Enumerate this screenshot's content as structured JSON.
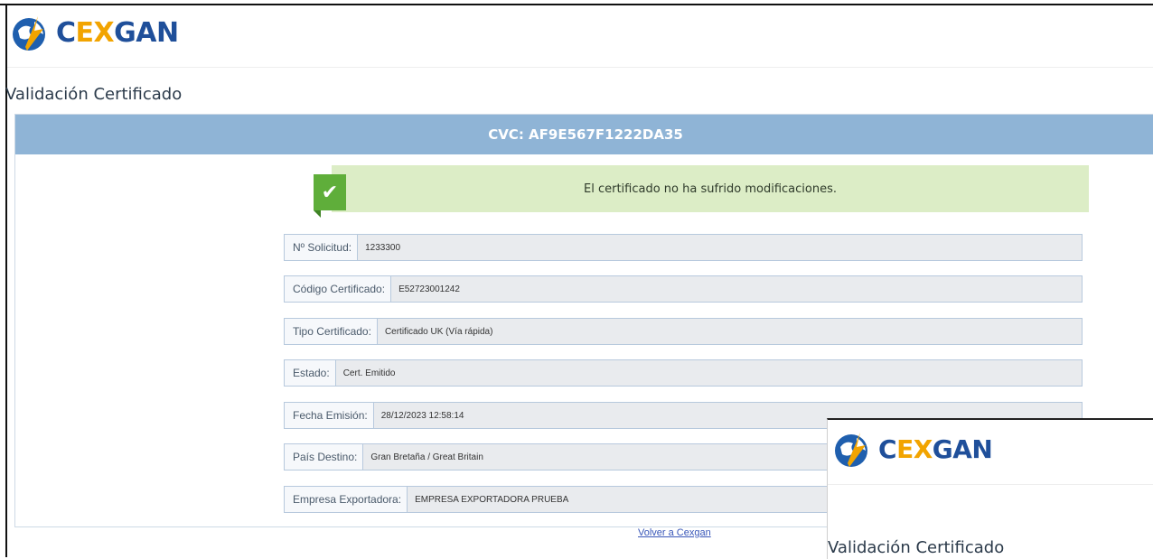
{
  "brand": {
    "part1": "C",
    "part2": "EX",
    "part3": "GAN",
    "colors": {
      "blue": "#1f4f9a",
      "orange": "#f2a400"
    }
  },
  "page_title": "Validación Certificado",
  "panel": {
    "header": "CVC: AF9E567F1222DA35",
    "header_color": "#8fb4d6",
    "alert": "El certificado no ha sufrido modificaciones.",
    "alert_icon": "check-icon",
    "fields": [
      {
        "label": "Nº Solicitud:",
        "value": "1233300"
      },
      {
        "label": "Código Certificado:",
        "value": "E52723001242"
      },
      {
        "label": "Tipo Certificado:",
        "value": "Certificado UK (Vía rápida)"
      },
      {
        "label": "Estado:",
        "value": "Cert. Emitido"
      },
      {
        "label": "Fecha Emisión:",
        "value": "28/12/2023 12:58:14"
      },
      {
        "label": "País Destino:",
        "value": "Gran Bretaña / Great Britain"
      },
      {
        "label": "Empresa Exportadora:",
        "value": "EMPRESA EXPORTADORA PRUEBA"
      }
    ]
  },
  "back_link": "Volver a Cexgan",
  "overlay": {
    "brand": {
      "part1": "C",
      "part2": "EX",
      "part3": "GAN"
    },
    "page_title": "Validación Certificado"
  }
}
